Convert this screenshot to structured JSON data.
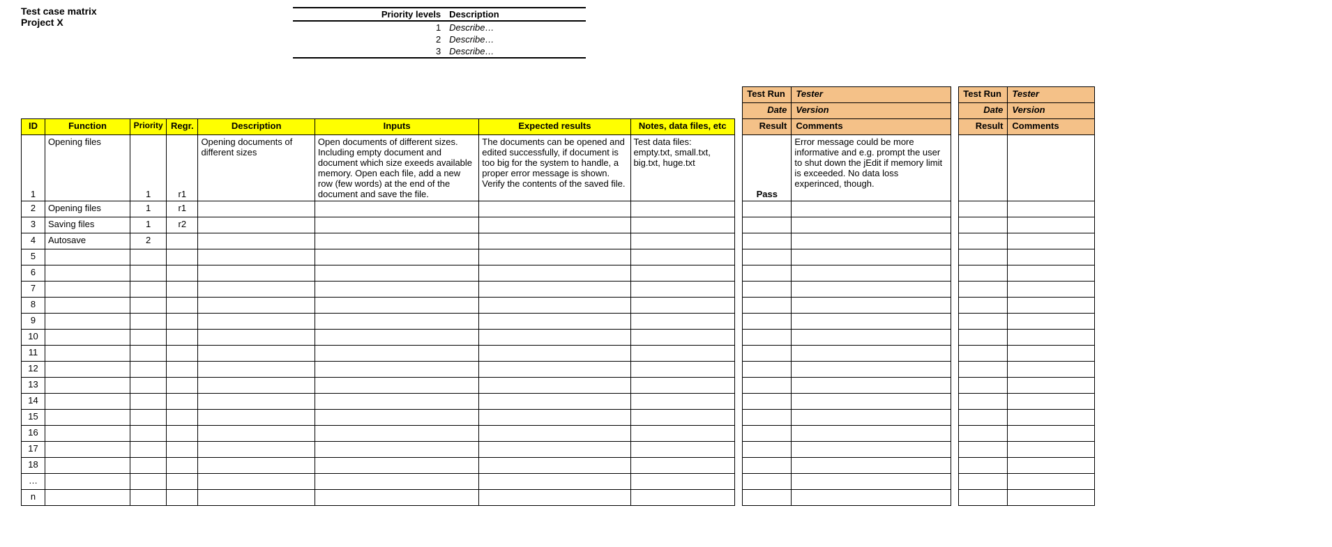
{
  "title": {
    "line1": "Test case matrix",
    "line2": "Project X"
  },
  "legend": {
    "header": {
      "levels": "Priority levels",
      "desc": "Description"
    },
    "rows": [
      {
        "n": "1",
        "d": "Describe…"
      },
      {
        "n": "2",
        "d": "Describe…"
      },
      {
        "n": "3",
        "d": "Describe…"
      }
    ]
  },
  "runHeaders": {
    "r1": {
      "testRun": "Test Run",
      "tester": "Tester"
    },
    "r2": {
      "date": "Date",
      "version": "Version"
    },
    "r3": {
      "result": "Result",
      "comments": "Comments"
    }
  },
  "mainHeaders": {
    "id": "ID",
    "func": "Function",
    "priority": "Priority",
    "regr": "Regr.",
    "desc": "Description",
    "inputs": "Inputs",
    "exp": "Expected results",
    "notes": "Notes, data files, etc"
  },
  "rows": [
    {
      "id": "1",
      "func": "Opening files",
      "priority": "1",
      "regr": "r1",
      "desc": "Opening documents of different sizes",
      "inputs": "Open documents of different sizes. Including empty document and document which size exeeds available memory. Open each file, add a new row (few words) at the end of the document and save the file.",
      "exp": "The documents can be opened and edited successfully, if document is too big for the system to handle, a proper error message is shown. Verify the contents of the saved file.",
      "notes": "Test data files: empty.txt, small.txt, big.txt, huge.txt",
      "result1": "Pass",
      "comments1": "Error message could be more informative and e.g. prompt the user to shut down the jEdit if memory limit is exceeded. No data loss experinced, though.",
      "result2": "",
      "comments2": ""
    },
    {
      "id": "2",
      "func": "Opening files",
      "priority": "1",
      "regr": "r1",
      "desc": "",
      "inputs": "",
      "exp": "",
      "notes": "",
      "result1": "",
      "comments1": "",
      "result2": "",
      "comments2": ""
    },
    {
      "id": "3",
      "func": "Saving files",
      "priority": "1",
      "regr": "r2",
      "desc": "",
      "inputs": "",
      "exp": "",
      "notes": "",
      "result1": "",
      "comments1": "",
      "result2": "",
      "comments2": ""
    },
    {
      "id": "4",
      "func": "Autosave",
      "priority": "2",
      "regr": "",
      "desc": "",
      "inputs": "",
      "exp": "",
      "notes": "",
      "result1": "",
      "comments1": "",
      "result2": "",
      "comments2": ""
    },
    {
      "id": "5",
      "func": "",
      "priority": "",
      "regr": "",
      "desc": "",
      "inputs": "",
      "exp": "",
      "notes": "",
      "result1": "",
      "comments1": "",
      "result2": "",
      "comments2": ""
    },
    {
      "id": "6",
      "func": "",
      "priority": "",
      "regr": "",
      "desc": "",
      "inputs": "",
      "exp": "",
      "notes": "",
      "result1": "",
      "comments1": "",
      "result2": "",
      "comments2": ""
    },
    {
      "id": "7",
      "func": "",
      "priority": "",
      "regr": "",
      "desc": "",
      "inputs": "",
      "exp": "",
      "notes": "",
      "result1": "",
      "comments1": "",
      "result2": "",
      "comments2": ""
    },
    {
      "id": "8",
      "func": "",
      "priority": "",
      "regr": "",
      "desc": "",
      "inputs": "",
      "exp": "",
      "notes": "",
      "result1": "",
      "comments1": "",
      "result2": "",
      "comments2": ""
    },
    {
      "id": "9",
      "func": "",
      "priority": "",
      "regr": "",
      "desc": "",
      "inputs": "",
      "exp": "",
      "notes": "",
      "result1": "",
      "comments1": "",
      "result2": "",
      "comments2": ""
    },
    {
      "id": "10",
      "func": "",
      "priority": "",
      "regr": "",
      "desc": "",
      "inputs": "",
      "exp": "",
      "notes": "",
      "result1": "",
      "comments1": "",
      "result2": "",
      "comments2": ""
    },
    {
      "id": "11",
      "func": "",
      "priority": "",
      "regr": "",
      "desc": "",
      "inputs": "",
      "exp": "",
      "notes": "",
      "result1": "",
      "comments1": "",
      "result2": "",
      "comments2": ""
    },
    {
      "id": "12",
      "func": "",
      "priority": "",
      "regr": "",
      "desc": "",
      "inputs": "",
      "exp": "",
      "notes": "",
      "result1": "",
      "comments1": "",
      "result2": "",
      "comments2": ""
    },
    {
      "id": "13",
      "func": "",
      "priority": "",
      "regr": "",
      "desc": "",
      "inputs": "",
      "exp": "",
      "notes": "",
      "result1": "",
      "comments1": "",
      "result2": "",
      "comments2": ""
    },
    {
      "id": "14",
      "func": "",
      "priority": "",
      "regr": "",
      "desc": "",
      "inputs": "",
      "exp": "",
      "notes": "",
      "result1": "",
      "comments1": "",
      "result2": "",
      "comments2": ""
    },
    {
      "id": "15",
      "func": "",
      "priority": "",
      "regr": "",
      "desc": "",
      "inputs": "",
      "exp": "",
      "notes": "",
      "result1": "",
      "comments1": "",
      "result2": "",
      "comments2": ""
    },
    {
      "id": "16",
      "func": "",
      "priority": "",
      "regr": "",
      "desc": "",
      "inputs": "",
      "exp": "",
      "notes": "",
      "result1": "",
      "comments1": "",
      "result2": "",
      "comments2": ""
    },
    {
      "id": "17",
      "func": "",
      "priority": "",
      "regr": "",
      "desc": "",
      "inputs": "",
      "exp": "",
      "notes": "",
      "result1": "",
      "comments1": "",
      "result2": "",
      "comments2": ""
    },
    {
      "id": "18",
      "func": "",
      "priority": "",
      "regr": "",
      "desc": "",
      "inputs": "",
      "exp": "",
      "notes": "",
      "result1": "",
      "comments1": "",
      "result2": "",
      "comments2": ""
    },
    {
      "id": "…",
      "func": "",
      "priority": "",
      "regr": "",
      "desc": "",
      "inputs": "",
      "exp": "",
      "notes": "",
      "result1": "",
      "comments1": "",
      "result2": "",
      "comments2": ""
    },
    {
      "id": "n",
      "func": "",
      "priority": "",
      "regr": "",
      "desc": "",
      "inputs": "",
      "exp": "",
      "notes": "",
      "result1": "",
      "comments1": "",
      "result2": "",
      "comments2": ""
    }
  ]
}
